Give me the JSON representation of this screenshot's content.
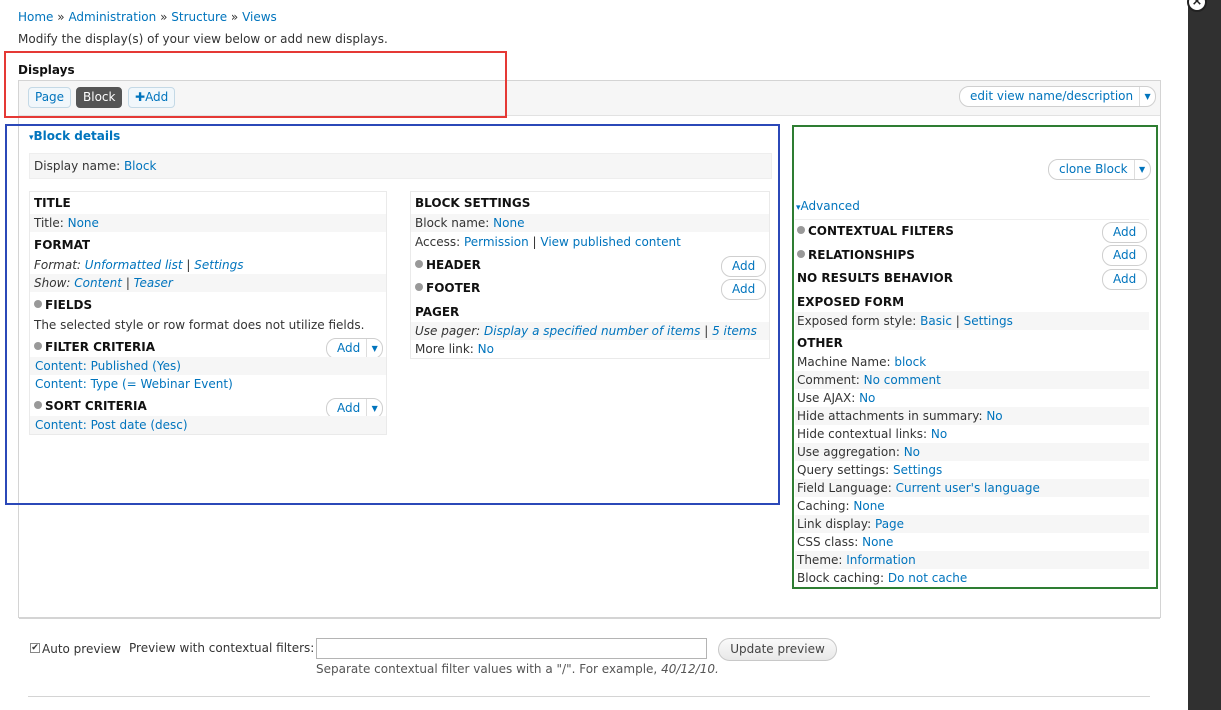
{
  "breadcrumb": {
    "items": [
      "Home",
      "Administration",
      "Structure",
      "Views"
    ],
    "separator": "»"
  },
  "intro_text": "Modify the display(s) of your view below or add new displays.",
  "displays": {
    "label": "Displays",
    "tabs": [
      {
        "label": "Page",
        "active": false
      },
      {
        "label": "Block",
        "active": true
      }
    ],
    "add_label": "Add",
    "edit_view_label": "edit view name/description"
  },
  "block_details": {
    "toggle_label": "Block details",
    "display_name_label": "Display name:",
    "display_name_value": "Block",
    "clone_label": "clone Block"
  },
  "left_column": {
    "title": {
      "heading": "TITLE",
      "label": "Title:",
      "value": "None"
    },
    "format": {
      "heading": "FORMAT",
      "format_label": "Format:",
      "format_value": "Unformatted list",
      "format_settings": "Settings",
      "show_label": "Show:",
      "show_value": "Content",
      "show_settings": "Teaser"
    },
    "fields": {
      "heading": "FIELDS",
      "note": "The selected style or row format does not utilize fields."
    },
    "filter_criteria": {
      "heading": "FILTER CRITERIA",
      "add_label": "Add",
      "items": [
        "Content: Published (Yes)",
        "Content: Type (= Webinar Event)"
      ]
    },
    "sort_criteria": {
      "heading": "SORT CRITERIA",
      "add_label": "Add",
      "items": [
        "Content: Post date (desc)"
      ]
    }
  },
  "middle_column": {
    "block_settings": {
      "heading": "BLOCK SETTINGS",
      "name_label": "Block name:",
      "name_value": "None",
      "access_label": "Access:",
      "access_value": "Permission",
      "access_settings": "View published content"
    },
    "header": {
      "heading": "HEADER",
      "add_label": "Add"
    },
    "footer": {
      "heading": "FOOTER",
      "add_label": "Add"
    },
    "pager": {
      "heading": "PAGER",
      "use_pager_label": "Use pager:",
      "use_pager_value": "Display a specified number of items",
      "use_pager_count": "5 items",
      "more_link_label": "More link:",
      "more_link_value": "No"
    }
  },
  "advanced": {
    "toggle_label": "Advanced",
    "contextual_filters": {
      "heading": "CONTEXTUAL FILTERS",
      "add_label": "Add"
    },
    "relationships": {
      "heading": "RELATIONSHIPS",
      "add_label": "Add"
    },
    "no_results": {
      "heading": "NO RESULTS BEHAVIOR",
      "add_label": "Add"
    },
    "exposed_form": {
      "heading": "EXPOSED FORM",
      "style_label": "Exposed form style:",
      "style_value": "Basic",
      "style_settings": "Settings"
    },
    "other": {
      "heading": "OTHER",
      "items": [
        {
          "label": "Machine Name:",
          "value": "block"
        },
        {
          "label": "Comment:",
          "value": "No comment"
        },
        {
          "label": "Use AJAX:",
          "value": "No"
        },
        {
          "label": "Hide attachments in summary:",
          "value": "No"
        },
        {
          "label": "Hide contextual links:",
          "value": "No"
        },
        {
          "label": "Use aggregation:",
          "value": "No"
        },
        {
          "label": "Query settings:",
          "value": "Settings"
        },
        {
          "label": "Field Language:",
          "value": "Current user's language"
        },
        {
          "label": "Caching:",
          "value": "None"
        },
        {
          "label": "Link display:",
          "value": "Page"
        },
        {
          "label": "CSS class:",
          "value": "None"
        },
        {
          "label": "Theme:",
          "value": "Information"
        },
        {
          "label": "Block caching:",
          "value": "Do not cache"
        }
      ]
    }
  },
  "preview": {
    "auto_preview_label": "Auto preview",
    "auto_preview_checked": true,
    "contextual_label": "Preview with contextual filters:",
    "contextual_value": "",
    "help_text": "Separate contextual filter values with a \"/\". For example,",
    "help_example": "40/12/10.",
    "update_label": "Update preview"
  },
  "colors": {
    "link": "#0074bd",
    "highlight_red": "#e53935",
    "highlight_blue": "#2b48b8",
    "highlight_green": "#2e7d32"
  },
  "icons": [
    "close-icon",
    "gear-icon",
    "plus-icon",
    "chevron-down-icon",
    "triangle-down-icon",
    "checkbox-icon"
  ]
}
